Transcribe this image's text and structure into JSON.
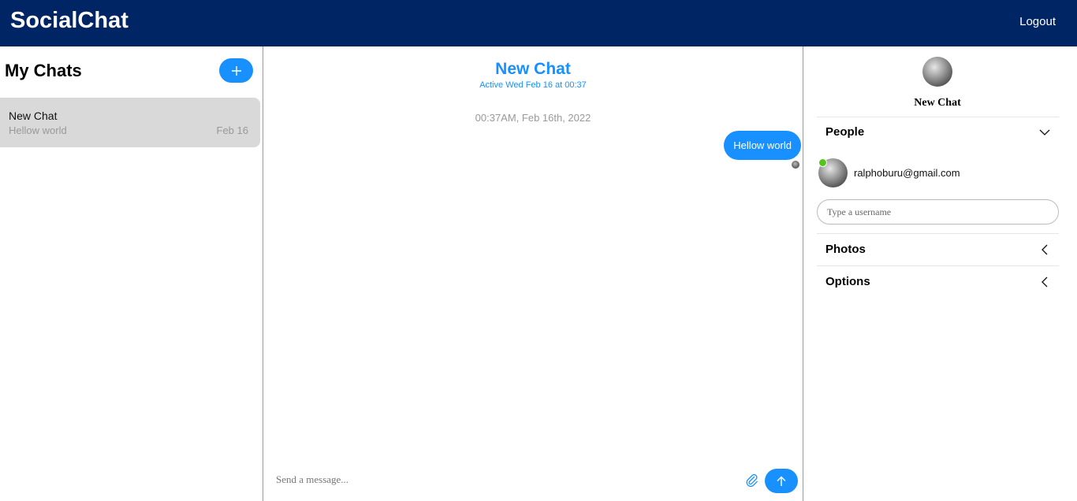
{
  "header": {
    "brand": "SocialChat",
    "logout_label": "Logout"
  },
  "sidebar": {
    "title": "My Chats",
    "add_icon": "plus-icon",
    "chats": [
      {
        "title": "New Chat",
        "last_message": "Hellow world",
        "date": "Feb 16"
      }
    ]
  },
  "chat": {
    "title": "New Chat",
    "subtitle": "Active Wed Feb 16 at 00:37",
    "timestamp": "00:37AM, Feb 16th, 2022",
    "messages": [
      {
        "text": "Hellow world"
      }
    ],
    "composer_placeholder": "Send a message...",
    "attach_icon": "paperclip-icon",
    "send_icon": "arrow-up-icon"
  },
  "settings": {
    "chat_title": "New Chat",
    "people_label": "People",
    "people": [
      {
        "email": "ralphoburu@gmail.com"
      }
    ],
    "username_placeholder": "Type a username",
    "photos_label": "Photos",
    "options_label": "Options"
  },
  "colors": {
    "header_bg": "#002564",
    "accent": "#1890ff",
    "online": "#52c41a",
    "selected_chat_bg": "#d9d9d9"
  }
}
